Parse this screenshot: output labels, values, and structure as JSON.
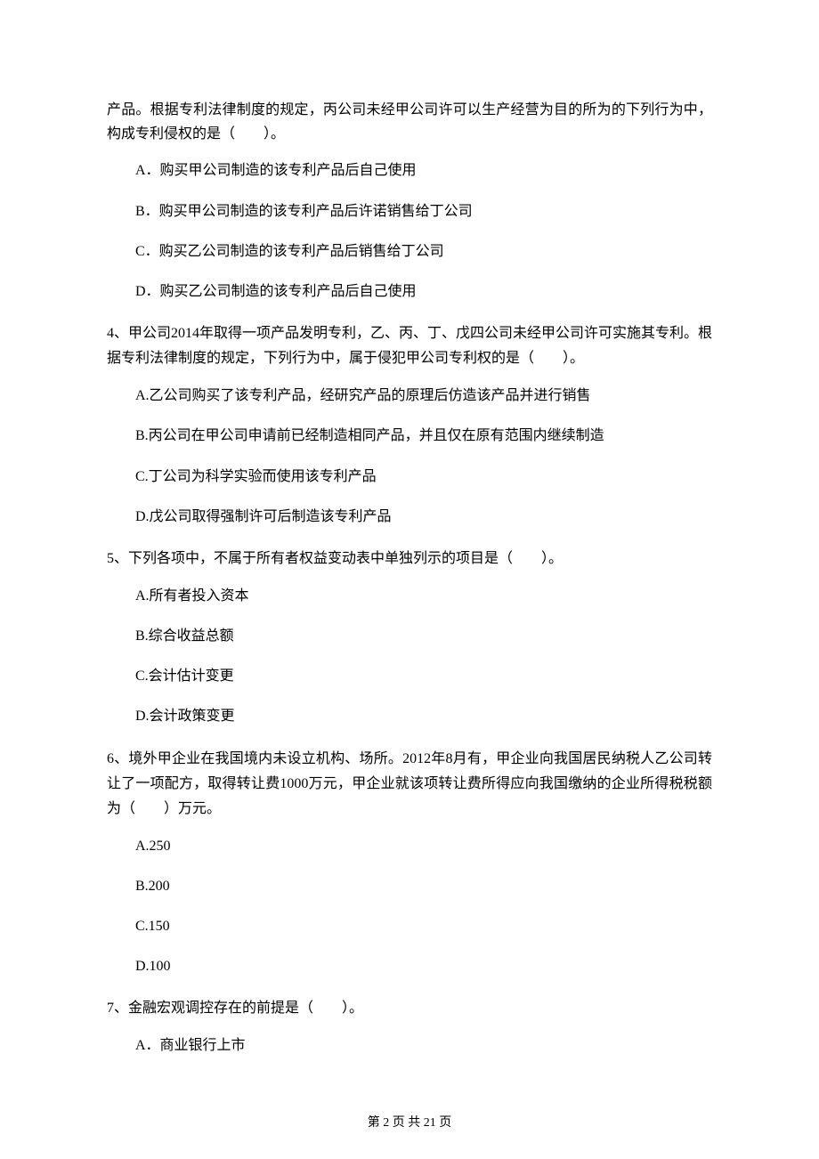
{
  "q3": {
    "cont": "产品。根据专利法律制度的规定，丙公司未经甲公司许可以生产经营为目的所为的下列行为中，构成专利侵权的是（　　）。",
    "opts": {
      "a": "A．购买甲公司制造的该专利产品后自己使用",
      "b": "B．购买甲公司制造的该专利产品后许诺销售给丁公司",
      "c": "C．购买乙公司制造的该专利产品后销售给丁公司",
      "d": "D．购买乙公司制造的该专利产品后自己使用"
    }
  },
  "q4": {
    "stem": "4、甲公司2014年取得一项产品发明专利，乙、丙、丁、戊四公司未经甲公司许可实施其专利。根据专利法律制度的规定，下列行为中，属于侵犯甲公司专利权的是（　　）。",
    "opts": {
      "a": "A.乙公司购买了该专利产品，经研究产品的原理后仿造该产品并进行销售",
      "b": "B.丙公司在甲公司申请前已经制造相同产品，并且仅在原有范围内继续制造",
      "c": "C.丁公司为科学实验而使用该专利产品",
      "d": "D.戊公司取得强制许可后制造该专利产品"
    }
  },
  "q5": {
    "stem": "5、下列各项中，不属于所有者权益变动表中单独列示的项目是（　　）。",
    "opts": {
      "a": "A.所有者投入资本",
      "b": "B.综合收益总额",
      "c": "C.会计估计变更",
      "d": "D.会计政策变更"
    }
  },
  "q6": {
    "stem": "6、境外甲企业在我国境内未设立机构、场所。2012年8月有，甲企业向我国居民纳税人乙公司转让了一项配方，取得转让费1000万元，甲企业就该项转让费所得应向我国缴纳的企业所得税税额为（　　）万元。",
    "opts": {
      "a": "A.250",
      "b": "B.200",
      "c": "C.150",
      "d": "D.100"
    }
  },
  "q7": {
    "stem": "7、金融宏观调控存在的前提是（　　）。",
    "opts": {
      "a": "A．商业银行上市"
    }
  },
  "footer": "第 2 页 共 21 页"
}
